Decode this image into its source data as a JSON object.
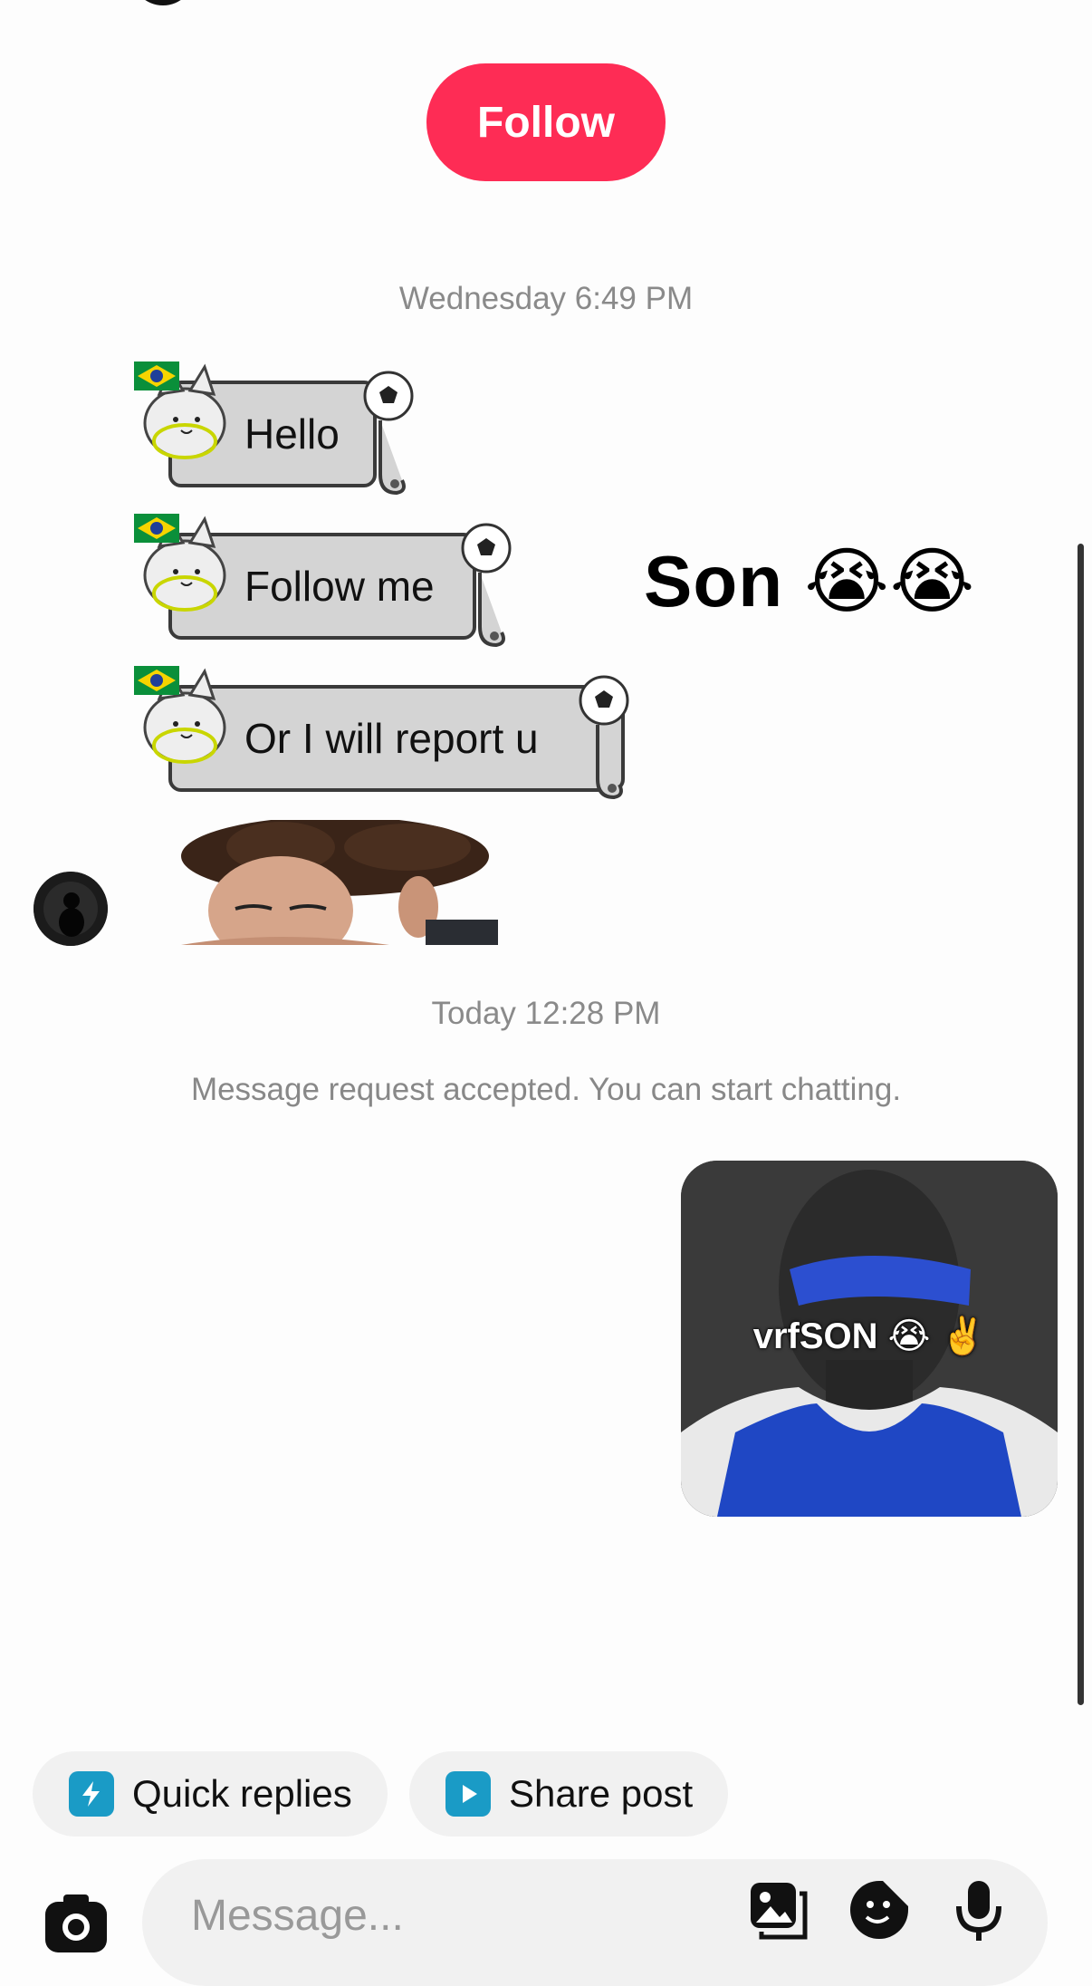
{
  "header": {
    "follow_label": "Follow"
  },
  "thread": {
    "timestamp_1": "Wednesday 6:49 PM",
    "stickers": [
      {
        "text": "Hello"
      },
      {
        "text": "Follow me"
      },
      {
        "text": "Or I will report u"
      }
    ],
    "side_text": "Son 😭😭",
    "timestamp_2": "Today 12:28 PM",
    "system_message": "Message request accepted. You can start chatting.",
    "image_caption": "vrfSON 😭 ✌️"
  },
  "quick_actions": {
    "quick_replies_label": "Quick replies",
    "share_post_label": "Share post"
  },
  "composer": {
    "placeholder": "Message..."
  },
  "colors": {
    "follow_accent": "#fe2c55",
    "chip_icon": "#1a9bc6"
  }
}
